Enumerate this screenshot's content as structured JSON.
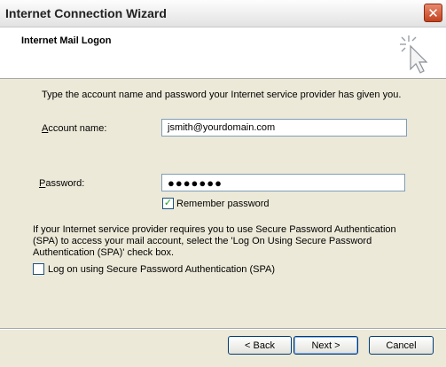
{
  "window": {
    "title": "Internet Connection Wizard"
  },
  "header": {
    "title": "Internet Mail Logon"
  },
  "intro": "Type the account name and password your Internet service provider has given you.",
  "account": {
    "label": "Account name:",
    "value": "jsmith@yourdomain.com"
  },
  "password": {
    "label": "Password:",
    "value": "●●●●●●●"
  },
  "remember": {
    "label": "Remember password",
    "checked": true
  },
  "spa_info": [
    "If your Internet service provider requires you to use Secure Password Authentication",
    "(SPA) to access your mail account, select the 'Log On Using Secure Password",
    "Authentication (SPA)' check box."
  ],
  "spa_checkbox": {
    "label": "Log on using Secure Password Authentication (SPA)",
    "checked": false
  },
  "buttons": {
    "back": "< Back",
    "next": "Next >",
    "cancel": "Cancel"
  },
  "icons": {
    "close": "close-icon",
    "wizard": "magic-wand-cursor-icon"
  }
}
